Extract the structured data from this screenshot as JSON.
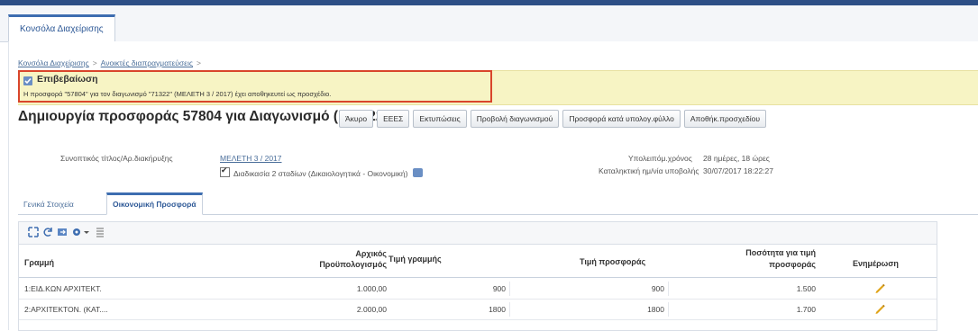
{
  "app_tab": "Κονσόλα Διαχείρισης",
  "breadcrumb": {
    "items": [
      "Κονσόλα Διαχείρισης",
      "Ανοικτές διαπραγματεύσεις"
    ],
    "separator": ">"
  },
  "confirmation": {
    "title": "Επιβεβαίωση",
    "message": "Η προσφορά \"57804\" για τον διαγωνισμό \"71322\" (ΜΕΛΕΤΗ 3 / 2017) έχει αποθηκευτεί ως προσχέδιο."
  },
  "page_title": "Δημιουργία προσφοράς 57804 για Διαγωνισμό (\"71322\")",
  "buttons": [
    "Άκυρο",
    "ΕΕΕΣ",
    "Εκτυπώσεις",
    "Προβολή διαγωνισμού",
    "Προσφορά κατά υπολογ.φύλλο",
    "Αποθήκ.προσχεδίου"
  ],
  "details": {
    "title_label": "Συνοπτικός τίτλος/Αρ.διακήρυξης",
    "title_value": "ΜΕΛΕΤΗ 3 / 2017",
    "two_stage_label": "Διαδικασία 2 σταδίων (Δικαιολογητικά - Οικονομική)",
    "remaining_label": "Υπολειπόμ.χρόνος",
    "remaining_value": "28 ημέρες, 18 ώρες",
    "deadline_label": "Καταληκτική ημ/νία υποβολής",
    "deadline_value": "30/07/2017 18:22:27"
  },
  "sub_tabs": {
    "general": "Γενικά Στοιχεία",
    "financial": "Οικονομική Προσφορά"
  },
  "table": {
    "headers": {
      "line": "Γραμμή",
      "budget_a": "Αρχικός",
      "budget_b": "Προϋπολογισμός",
      "line_price": "Τιμή γραμμής",
      "offer_price": "Τιμή προσφοράς",
      "qty_a": "Ποσότητα για τιμή",
      "qty_b": "προσφοράς",
      "update": "Ενημέρωση"
    },
    "rows": [
      {
        "line": "1:ΕΙΔ.ΚΩΝ ΑΡΧΙΤΕΚΤ.",
        "budget": "1.000,00",
        "line_price": "900",
        "offer_price": "900",
        "qty": "1.500"
      },
      {
        "line": "2:ΑΡΧΙΤΕΚΤΟΝ. (ΚΑΤ....",
        "budget": "2.000,00",
        "line_price": "1800",
        "offer_price": "1800",
        "qty": "1.700"
      }
    ]
  },
  "colors": {
    "accent": "#3d6db0",
    "confirm_bg": "#f7f4c4",
    "highlight_border": "#d9452b",
    "pencil": "#e0a418"
  }
}
